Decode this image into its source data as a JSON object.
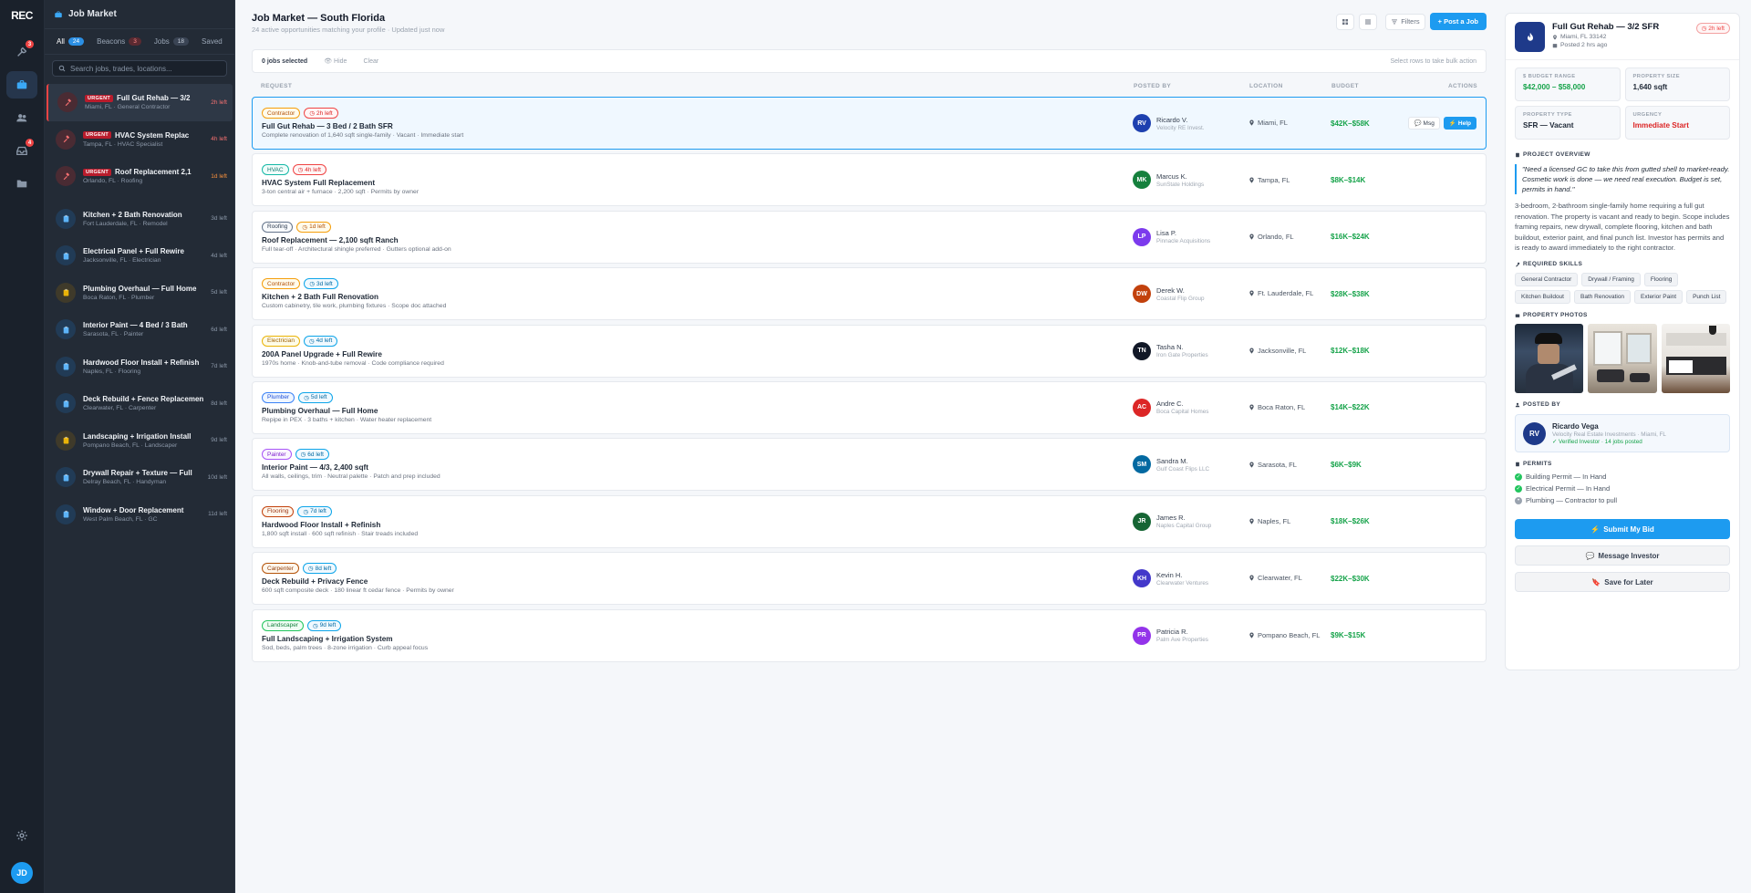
{
  "rail": {
    "logo": "REC",
    "badges": {
      "jobs": "3",
      "inbox": "4"
    },
    "avatar": "JD"
  },
  "sidebar": {
    "title": "Job Market",
    "tabs": [
      {
        "label": "All",
        "count": "24"
      },
      {
        "label": "Beacons",
        "count": "3"
      },
      {
        "label": "Jobs",
        "count": "18"
      },
      {
        "label": "Saved",
        "count": ""
      }
    ],
    "search_placeholder": "Search jobs, trades, locations...",
    "urgent_label": "URGENT",
    "items": [
      {
        "title": "Full Gut Rehab — 3/2",
        "sub": "Miami, FL · General Contractor",
        "time": "2h left",
        "urgent": true
      },
      {
        "title": "HVAC System Replac",
        "sub": "Tampa, FL · HVAC Specialist",
        "time": "4h left",
        "urgent": true
      },
      {
        "title": "Roof Replacement 2,1",
        "sub": "Orlando, FL · Roofing",
        "time": "1d left",
        "urgent": true
      },
      {
        "title": "Kitchen + 2 Bath Renovation",
        "sub": "Fort Lauderdale, FL · Remodel",
        "time": "3d left"
      },
      {
        "title": "Electrical Panel + Full Rewire",
        "sub": "Jacksonville, FL · Electrician",
        "time": "4d left"
      },
      {
        "title": "Plumbing Overhaul — Full Home",
        "sub": "Boca Raton, FL · Plumber",
        "time": "5d left"
      },
      {
        "title": "Interior Paint — 4 Bed / 3 Bath",
        "sub": "Sarasota, FL · Painter",
        "time": "6d left"
      },
      {
        "title": "Hardwood Floor Install + Refinish",
        "sub": "Naples, FL · Flooring",
        "time": "7d left"
      },
      {
        "title": "Deck Rebuild + Fence Replacement",
        "sub": "Clearwater, FL · Carpenter",
        "time": "8d left"
      },
      {
        "title": "Landscaping + Irrigation Install",
        "sub": "Pompano Beach, FL · Landscaper",
        "time": "9d left"
      },
      {
        "title": "Drywall Repair + Texture — Full",
        "sub": "Delray Beach, FL · Handyman",
        "time": "10d left"
      },
      {
        "title": "Window + Door Replacement",
        "sub": "West Palm Beach, FL · GC",
        "time": "11d left"
      }
    ]
  },
  "main": {
    "title": "Job Market — South Florida",
    "subtitle": "24 active opportunities matching your profile · Updated just now",
    "filters_label": "Filters",
    "post_label": "+ Post a Job",
    "selection": {
      "count": "0 jobs selected",
      "hide": "Hide",
      "clear": "Clear",
      "hint": "Select rows to take bulk action"
    },
    "columns": {
      "request": "REQUEST",
      "posted_by": "POSTED BY",
      "location": "LOCATION",
      "budget": "BUDGET",
      "actions": "ACTIONS"
    },
    "msg_label": "Msg",
    "help_label": "Help",
    "rows": [
      {
        "trade": "Contractor",
        "time": "2h left",
        "title": "Full Gut Rehab — 3 Bed / 2 Bath SFR",
        "desc": "Complete renovation of 1,640 sqft single-family · Vacant · Immediate start",
        "initials": "RV",
        "name": "Ricardo V.",
        "org": "Velocity RE Invest.",
        "loc": "Miami, FL",
        "budget": "$42K–$58K"
      },
      {
        "trade": "HVAC",
        "time": "4h left",
        "title": "HVAC System Full Replacement",
        "desc": "3-ton central air + furnace · 2,200 sqft · Permits by owner",
        "initials": "MK",
        "name": "Marcus K.",
        "org": "SunState Holdings",
        "loc": "Tampa, FL",
        "budget": "$8K–$14K"
      },
      {
        "trade": "Roofing",
        "time": "1d left",
        "title": "Roof Replacement — 2,100 sqft Ranch",
        "desc": "Full tear-off · Architectural shingle preferred · Gutters optional add-on",
        "initials": "LP",
        "name": "Lisa P.",
        "org": "Pinnacle Acquisitions",
        "loc": "Orlando, FL",
        "budget": "$16K–$24K"
      },
      {
        "trade": "Contractor",
        "time": "3d left",
        "title": "Kitchen + 2 Bath Full Renovation",
        "desc": "Custom cabinetry, tile work, plumbing fixtures · Scope doc attached",
        "initials": "DW",
        "name": "Derek W.",
        "org": "Coastal Flip Group",
        "loc": "Ft. Lauderdale, FL",
        "budget": "$28K–$38K"
      },
      {
        "trade": "Electrician",
        "time": "4d left",
        "title": "200A Panel Upgrade + Full Rewire",
        "desc": "1970s home · Knob-and-tube removal · Code compliance required",
        "initials": "TN",
        "name": "Tasha N.",
        "org": "Iron Gate Properties",
        "loc": "Jacksonville, FL",
        "budget": "$12K–$18K"
      },
      {
        "trade": "Plumber",
        "time": "5d left",
        "title": "Plumbing Overhaul — Full Home",
        "desc": "Repipe in PEX · 3 baths + kitchen · Water heater replacement",
        "initials": "AC",
        "name": "Andre C.",
        "org": "Boca Capital Homes",
        "loc": "Boca Raton, FL",
        "budget": "$14K–$22K"
      },
      {
        "trade": "Painter",
        "time": "6d left",
        "title": "Interior Paint — 4/3, 2,400 sqft",
        "desc": "All walls, ceilings, trim · Neutral palette · Patch and prep included",
        "initials": "SM",
        "name": "Sandra M.",
        "org": "Gulf Coast Flips LLC",
        "loc": "Sarasota, FL",
        "budget": "$6K–$9K"
      },
      {
        "trade": "Flooring",
        "time": "7d left",
        "title": "Hardwood Floor Install + Refinish",
        "desc": "1,800 sqft install · 600 sqft refinish · Stair treads included",
        "initials": "JR",
        "name": "James R.",
        "org": "Naples Capital Group",
        "loc": "Naples, FL",
        "budget": "$18K–$26K"
      },
      {
        "trade": "Carpenter",
        "time": "8d left",
        "title": "Deck Rebuild + Privacy Fence",
        "desc": "600 sqft composite deck · 180 linear ft cedar fence · Permits by owner",
        "initials": "KH",
        "name": "Kevin H.",
        "org": "Clearwater Ventures",
        "loc": "Clearwater, FL",
        "budget": "$22K–$30K"
      },
      {
        "trade": "Landscaper",
        "time": "9d left",
        "title": "Full Landscaping + Irrigation System",
        "desc": "Sod, beds, palm trees · 8-zone irrigation · Curb appeal focus",
        "initials": "PR",
        "name": "Patricia R.",
        "org": "Palm Ave Properties",
        "loc": "Pompano Beach, FL",
        "budget": "$9K–$15K"
      }
    ]
  },
  "detail": {
    "title": "Full Gut Rehab — 3/2 SFR",
    "location": "Miami, FL 33142",
    "posted": "Posted 2 hrs ago",
    "time": "2h left",
    "cards": [
      {
        "label": "$ BUDGET RANGE",
        "value": "$42,000 – $58,000"
      },
      {
        "label": "PROPERTY SIZE",
        "value": "1,640 sqft"
      },
      {
        "label": "PROPERTY TYPE",
        "value": "SFR — Vacant"
      },
      {
        "label": "URGENCY",
        "value": "Immediate Start"
      }
    ],
    "overview_title": "PROJECT OVERVIEW",
    "quote": "\"Need a licensed GC to take this from gutted shell to market-ready. Cosmetic work is done — we need real execution. Budget is set, permits in hand.\"",
    "para": "3-bedroom, 2-bathroom single-family home requiring a full gut renovation. The property is vacant and ready to begin. Scope includes framing repairs, new drywall, complete flooring, kitchen and bath buildout, exterior paint, and final punch list. Investor has permits and is ready to award immediately to the right contractor.",
    "skills_title": "REQUIRED SKILLS",
    "skills": [
      "General Contractor",
      "Drywall / Framing",
      "Flooring",
      "Kitchen Buildout",
      "Bath Renovation",
      "Exterior Paint",
      "Punch List"
    ],
    "photos_title": "PROPERTY PHOTOS",
    "posted_by_title": "POSTED BY",
    "poster": {
      "initials": "RV",
      "name": "Ricardo Vega",
      "org": "Velocity Real Estate Investments · Miami, FL",
      "verified": "Verified Investor · 14 jobs posted"
    },
    "permits_title": "PERMITS",
    "permits": [
      {
        "label": "Building Permit — In Hand",
        "ok": true
      },
      {
        "label": "Electrical Permit — In Hand",
        "ok": true
      },
      {
        "label": "Plumbing — Contractor to pull",
        "ok": false
      }
    ],
    "submit": "Submit My Bid",
    "message": "Message Investor",
    "save": "Save for Later"
  },
  "colors": {
    "accent": "#1d9bf0",
    "budget": "#16a34a",
    "urgent": "#ef4444"
  }
}
